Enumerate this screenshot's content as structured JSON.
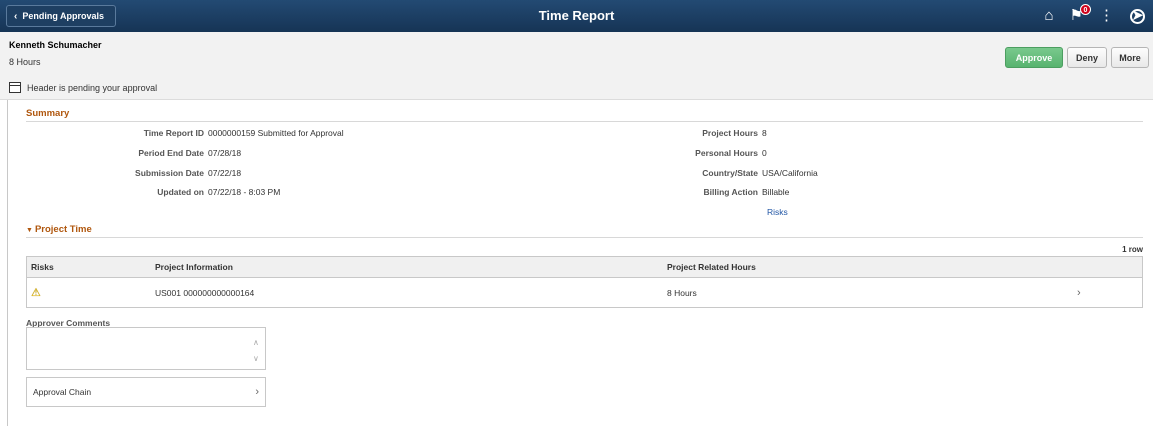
{
  "banner": {
    "back_label": "Pending Approvals",
    "title": "Time Report",
    "notification_count": "0"
  },
  "header": {
    "employee_name": "Kenneth Schumacher",
    "hours": "8  Hours",
    "pending_text": "Header is pending your approval",
    "approve_label": "Approve",
    "deny_label": "Deny",
    "more_label": "More"
  },
  "summary": {
    "title": "Summary",
    "left": [
      {
        "label": "Time Report ID",
        "value": "0000000159   Submitted for Approval"
      },
      {
        "label": "Period End Date",
        "value": "07/28/18"
      },
      {
        "label": "Submission Date",
        "value": "07/22/18"
      },
      {
        "label": "Updated on",
        "value": "07/22/18 - 8:03 PM"
      }
    ],
    "right": [
      {
        "label": "Project Hours",
        "value": "8"
      },
      {
        "label": "Personal Hours",
        "value": "0"
      },
      {
        "label": "Country/State",
        "value": "USA/California"
      },
      {
        "label": "Billing Action",
        "value": "Billable"
      }
    ],
    "risks_link": "Risks"
  },
  "project_time": {
    "title": "Project Time",
    "row_count": "1 row",
    "columns": [
      "Risks",
      "Project Information",
      "Project Related Hours"
    ],
    "rows": [
      {
        "project_info": "US001   000000000000164",
        "hours": "8  Hours"
      }
    ]
  },
  "approver_comments": {
    "label": "Approver Comments",
    "value": ""
  },
  "approval_chain": {
    "label": "Approval Chain"
  }
}
